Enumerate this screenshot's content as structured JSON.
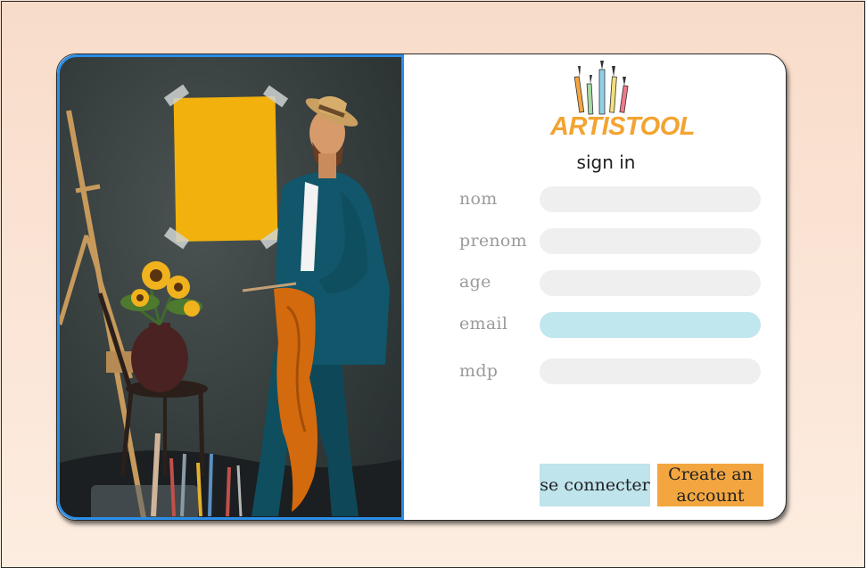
{
  "brand": {
    "name": "ARTISTOOL"
  },
  "form": {
    "title": "sign in",
    "fields": [
      {
        "key": "nom",
        "label": "nom",
        "value": ""
      },
      {
        "key": "prenom",
        "label": "prenom",
        "value": ""
      },
      {
        "key": "age",
        "label": "age",
        "value": ""
      },
      {
        "key": "email",
        "label": "email",
        "value": "",
        "focused": true
      },
      {
        "key": "mdp",
        "label": "mdp",
        "value": ""
      }
    ],
    "buttons": {
      "login_label": "se connecter",
      "create_label": "Create an account"
    }
  },
  "colors": {
    "accent_orange": "#f3a640",
    "brand_orange": "#f2a432",
    "login_blue": "#bfe4ec",
    "focus_blue": "#c0e6ee",
    "frame_blue": "#2b8ee8"
  },
  "icons": {
    "logo": "paint-brushes-icon"
  }
}
